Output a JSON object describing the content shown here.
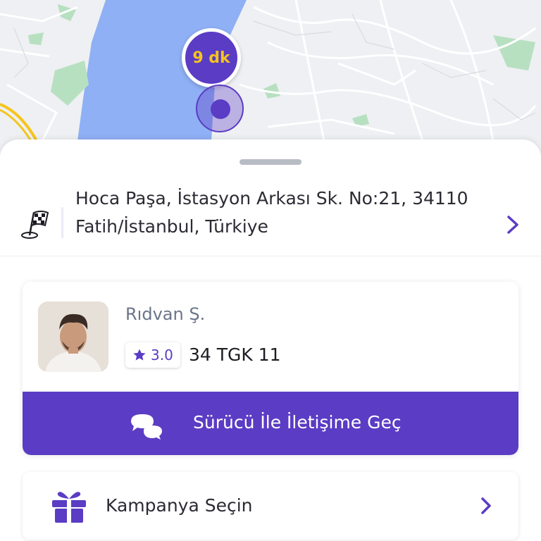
{
  "map": {
    "eta_label": "9 dk"
  },
  "destination": {
    "address": "Hoca Paşa, İstasyon Arkası Sk. No:21, 34110 Fatih/İstanbul, Türkiye",
    "flag_icon": "checkered-flag-icon",
    "chevron_icon": "chevron-right-icon"
  },
  "driver": {
    "name": "Rıdvan Ş.",
    "rating": "3.0",
    "plate": "34 TGK 11",
    "avatar": "driver-avatar"
  },
  "contact": {
    "label": "Sürücü İle İletişime Geç",
    "icon": "chat-bubbles-icon"
  },
  "campaign": {
    "label": "Kampanya Seçin",
    "icon": "gift-icon"
  },
  "colors": {
    "brand": "#5b3cc4",
    "eta_text": "#f5c51c",
    "water": "#8fb0f5",
    "park": "#b7e0c0"
  }
}
